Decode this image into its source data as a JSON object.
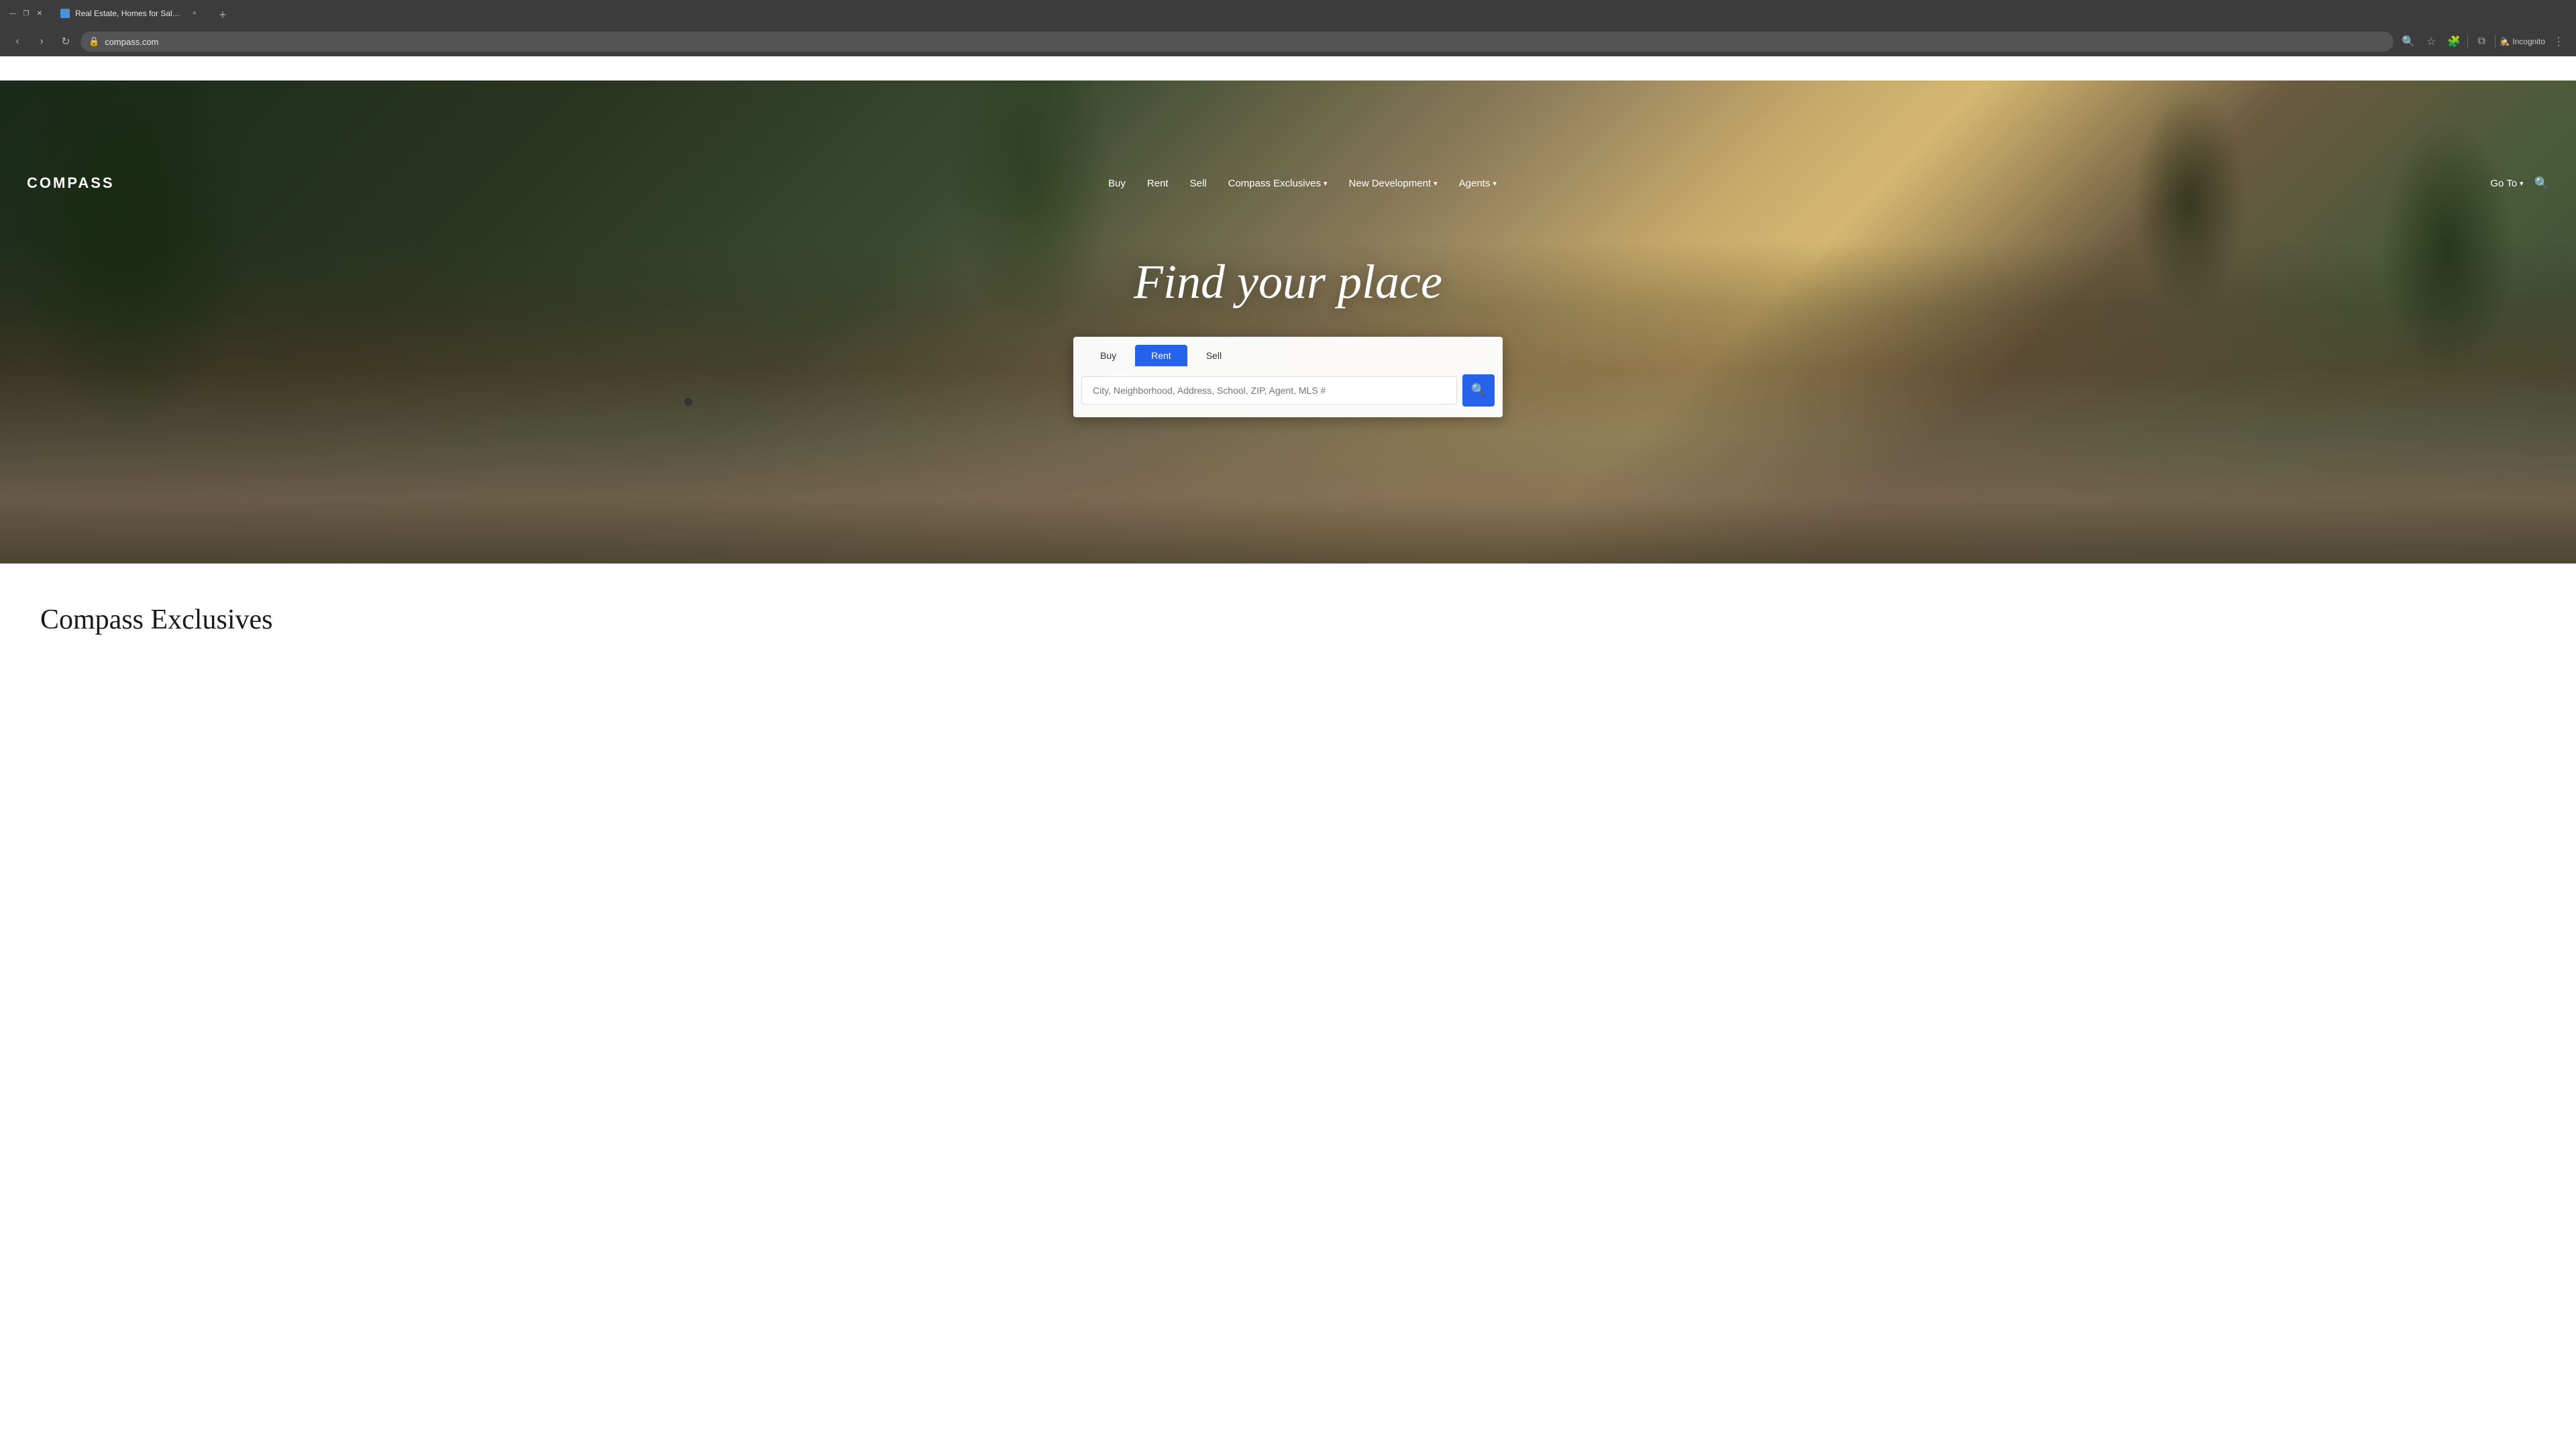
{
  "browser": {
    "tab_title": "Real Estate, Homes for Sale & ...",
    "tab_close": "×",
    "tab_new": "+",
    "nav_back": "‹",
    "nav_forward": "›",
    "nav_refresh": "↻",
    "address": "compass.com",
    "toolbar_search_icon": "🔍",
    "toolbar_bookmark_icon": "☆",
    "toolbar_extensions_icon": "🧩",
    "toolbar_profile_icon": "👤",
    "toolbar_menu_icon": "⋮",
    "incognito_label": "Incognito",
    "window_minimize": "—",
    "window_maximize": "❐",
    "window_close": "✕"
  },
  "nav": {
    "logo": "COMPASS",
    "links": [
      {
        "label": "Buy",
        "has_dropdown": false
      },
      {
        "label": "Rent",
        "has_dropdown": false
      },
      {
        "label": "Sell",
        "has_dropdown": false
      },
      {
        "label": "Compass Exclusives",
        "has_dropdown": true
      },
      {
        "label": "New Development",
        "has_dropdown": true
      },
      {
        "label": "Agents",
        "has_dropdown": true
      }
    ],
    "goto_label": "Go To",
    "goto_has_dropdown": true
  },
  "hero": {
    "title": "Find your place",
    "search": {
      "tabs": [
        {
          "label": "Buy",
          "active": false
        },
        {
          "label": "Rent",
          "active": true
        },
        {
          "label": "Sell",
          "active": false
        }
      ],
      "placeholder": "City, Neighborhood, Address, School, ZIP, Agent, MLS #",
      "button_icon": "🔍"
    }
  },
  "below": {
    "section_title": "Compass Exclusives"
  }
}
